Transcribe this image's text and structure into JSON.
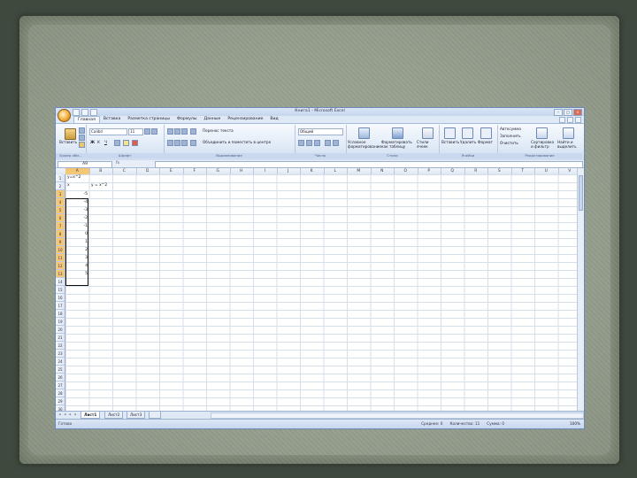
{
  "window": {
    "title": "Книга1 - Microsoft Excel"
  },
  "qat": [
    "save",
    "undo",
    "redo"
  ],
  "tabs": [
    {
      "label": "Главная",
      "active": true
    },
    {
      "label": "Вставка"
    },
    {
      "label": "Разметка страницы"
    },
    {
      "label": "Формулы"
    },
    {
      "label": "Данные"
    },
    {
      "label": "Рецензирование"
    },
    {
      "label": "Вид"
    }
  ],
  "ribbon": {
    "clipboard": {
      "paste": "Вставить",
      "label": "Буфер обм..."
    },
    "font": {
      "name": "Calibri",
      "size": "11",
      "label": "Шрифт"
    },
    "alignment": {
      "wrap": "Перенос текста",
      "merge": "Объединить и поместить в центре",
      "label": "Выравнивание"
    },
    "number": {
      "format": "Общий",
      "label": "Число"
    },
    "styles": {
      "conditional": "Условное форматирование",
      "table": "Форматировать как таблицу",
      "cell": "Стили ячеек",
      "label": "Стили"
    },
    "cells": {
      "insert": "Вставить",
      "delete": "Удалить",
      "format": "Формат",
      "label": "Ячейки"
    },
    "editing": {
      "autosum": "Автосумма",
      "fill": "Заполнить",
      "clear": "Очистить",
      "sort": "Сортировка и фильтр",
      "find": "Найти и выделить",
      "label": "Редактирование"
    }
  },
  "formula_bar": {
    "name_box": "A9",
    "fx": "fx",
    "value": ""
  },
  "columns": [
    "A",
    "B",
    "C",
    "D",
    "E",
    "F",
    "G",
    "H",
    "I",
    "J",
    "K",
    "L",
    "M",
    "N",
    "O",
    "P",
    "Q",
    "R",
    "S",
    "T",
    "U",
    "V"
  ],
  "rows": [
    "1",
    "2",
    "3",
    "4",
    "5",
    "6",
    "7",
    "8",
    "9",
    "10",
    "11",
    "12",
    "13",
    "14",
    "15",
    "16",
    "17",
    "18",
    "19",
    "20",
    "21",
    "22",
    "23",
    "24",
    "25",
    "26",
    "27",
    "28",
    "29",
    "30",
    "31",
    "32",
    "33",
    "34",
    "35"
  ],
  "cells": {
    "a1": "y=x^2",
    "a2": "x",
    "b2": "y = x^2",
    "xvals": [
      "-5",
      "-4",
      "-3",
      "-2",
      "-1",
      "0",
      "1",
      "2",
      "3",
      "4",
      "5"
    ]
  },
  "sheet_tabs": [
    "Лист1",
    "Лист2",
    "Лист3"
  ],
  "status": {
    "left": "Готово",
    "avg": "Среднее: 0",
    "count": "Количество: 11",
    "sum": "Сумма: 0",
    "zoom": "100%"
  }
}
